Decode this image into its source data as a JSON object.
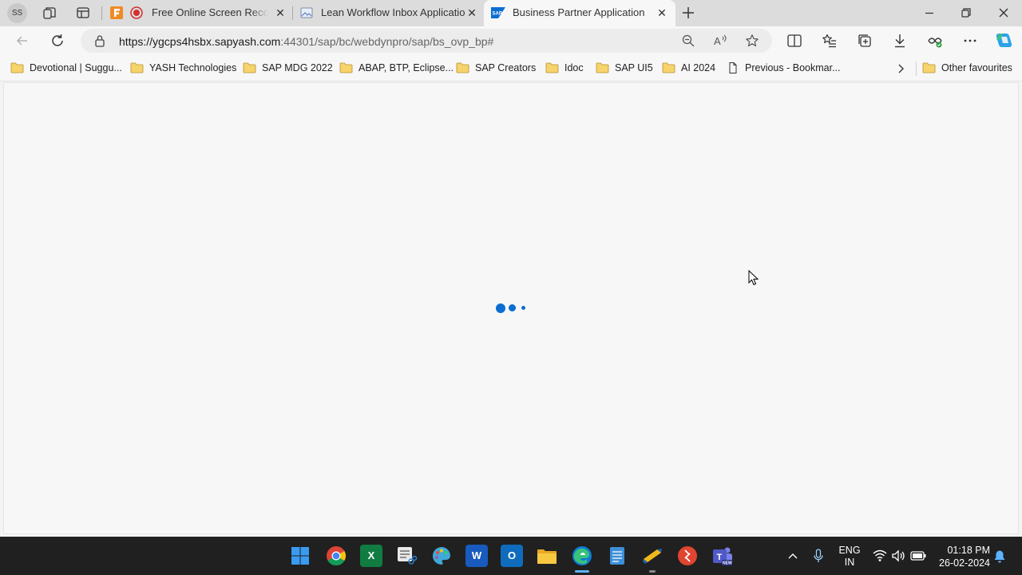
{
  "browser": {
    "profile_initials": "SS",
    "tabs": [
      {
        "title": "Free Online Screen Recorder",
        "favicon": "recorder-icon",
        "active": false
      },
      {
        "title": "Lean Workflow Inbox Application",
        "favicon": "page-icon",
        "active": false
      },
      {
        "title": "Business Partner Application",
        "favicon": "sap-icon",
        "active": true
      }
    ],
    "address": {
      "host": "https://ygcps4hsbx.sapyash.com",
      "path": ":44301/sap/bc/webdynpro/sap/bs_ovp_bp#"
    },
    "favourites": [
      {
        "label": "Devotional | Suggu...",
        "icon": "folder-icon"
      },
      {
        "label": "YASH Technologies",
        "icon": "folder-icon"
      },
      {
        "label": "SAP MDG 2022",
        "icon": "folder-icon"
      },
      {
        "label": "ABAP, BTP, Eclipse...",
        "icon": "folder-icon"
      },
      {
        "label": "SAP Creators",
        "icon": "folder-icon"
      },
      {
        "label": "Idoc",
        "icon": "folder-icon"
      },
      {
        "label": "SAP UI5",
        "icon": "folder-icon"
      },
      {
        "label": "AI 2024",
        "icon": "folder-icon"
      },
      {
        "label": "Previous - Bookmar...",
        "icon": "page-icon"
      },
      {
        "label": "Other favourites",
        "icon": "folder-icon"
      }
    ]
  },
  "page": {
    "state": "loading"
  },
  "taskbar": {
    "apps": [
      "windows-start",
      "chrome",
      "excel",
      "snipping-tool",
      "paint",
      "word",
      "outlook",
      "file-explorer",
      "edge",
      "notepad",
      "sap-logon",
      "remote-desktop",
      "teams"
    ],
    "tray": {
      "language_top": "ENG",
      "language_bottom": "IN",
      "time": "01:18 PM",
      "date": "26-02-2024"
    }
  },
  "colors": {
    "accent": "#0a6ed1",
    "taskbar": "#202020",
    "titlebar": "#dcdcdc"
  }
}
